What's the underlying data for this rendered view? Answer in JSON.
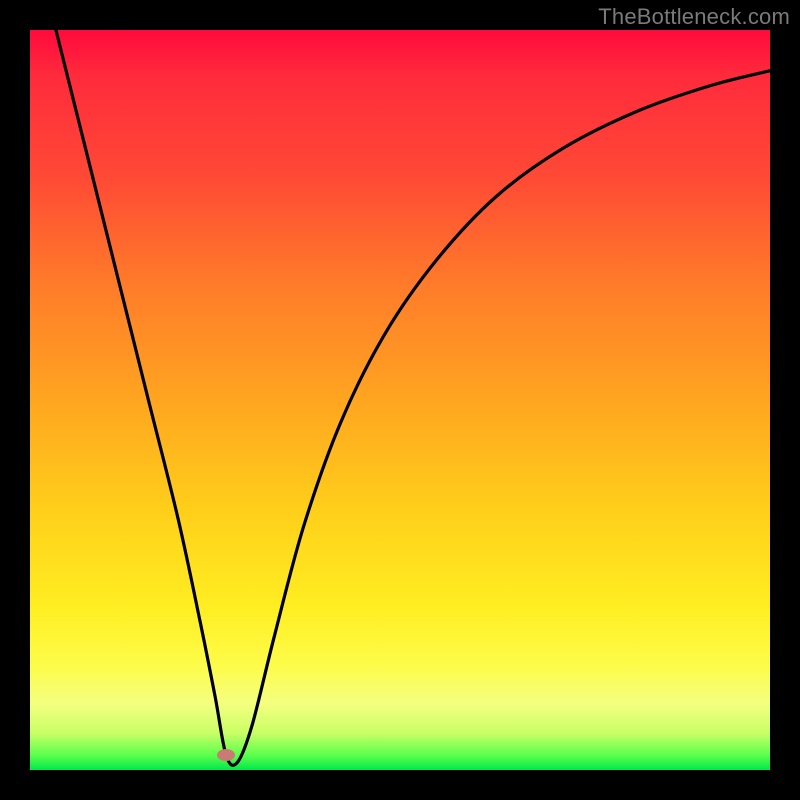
{
  "watermark": "TheBottleneck.com",
  "colors": {
    "background": "#000000",
    "curve": "#000000",
    "marker": "#c97a73"
  },
  "chart_data": {
    "type": "line",
    "title": "",
    "xlabel": "",
    "ylabel": "",
    "xlim": [
      0,
      100
    ],
    "ylim": [
      0,
      100
    ],
    "grid": false,
    "legend": false,
    "annotations": [],
    "series": [
      {
        "name": "bottleneck-curve",
        "x": [
          3.5,
          8,
          12,
          16,
          20,
          23,
          25,
          26.5,
          28,
          30,
          33,
          37,
          42,
          48,
          55,
          63,
          72,
          82,
          92,
          100
        ],
        "y": [
          100,
          82,
          66,
          50,
          34,
          20,
          10,
          2,
          1,
          6,
          18,
          33,
          47,
          59,
          69,
          77.5,
          84,
          89,
          92.5,
          94.5
        ]
      }
    ],
    "marker": {
      "x": 26.5,
      "y": 2
    },
    "background_gradient": {
      "direction": "vertical",
      "stops": [
        {
          "pos": 0,
          "color": "#ff0a3c"
        },
        {
          "pos": 50,
          "color": "#ffa520"
        },
        {
          "pos": 80,
          "color": "#ffee22"
        },
        {
          "pos": 100,
          "color": "#00e84a"
        }
      ]
    }
  }
}
